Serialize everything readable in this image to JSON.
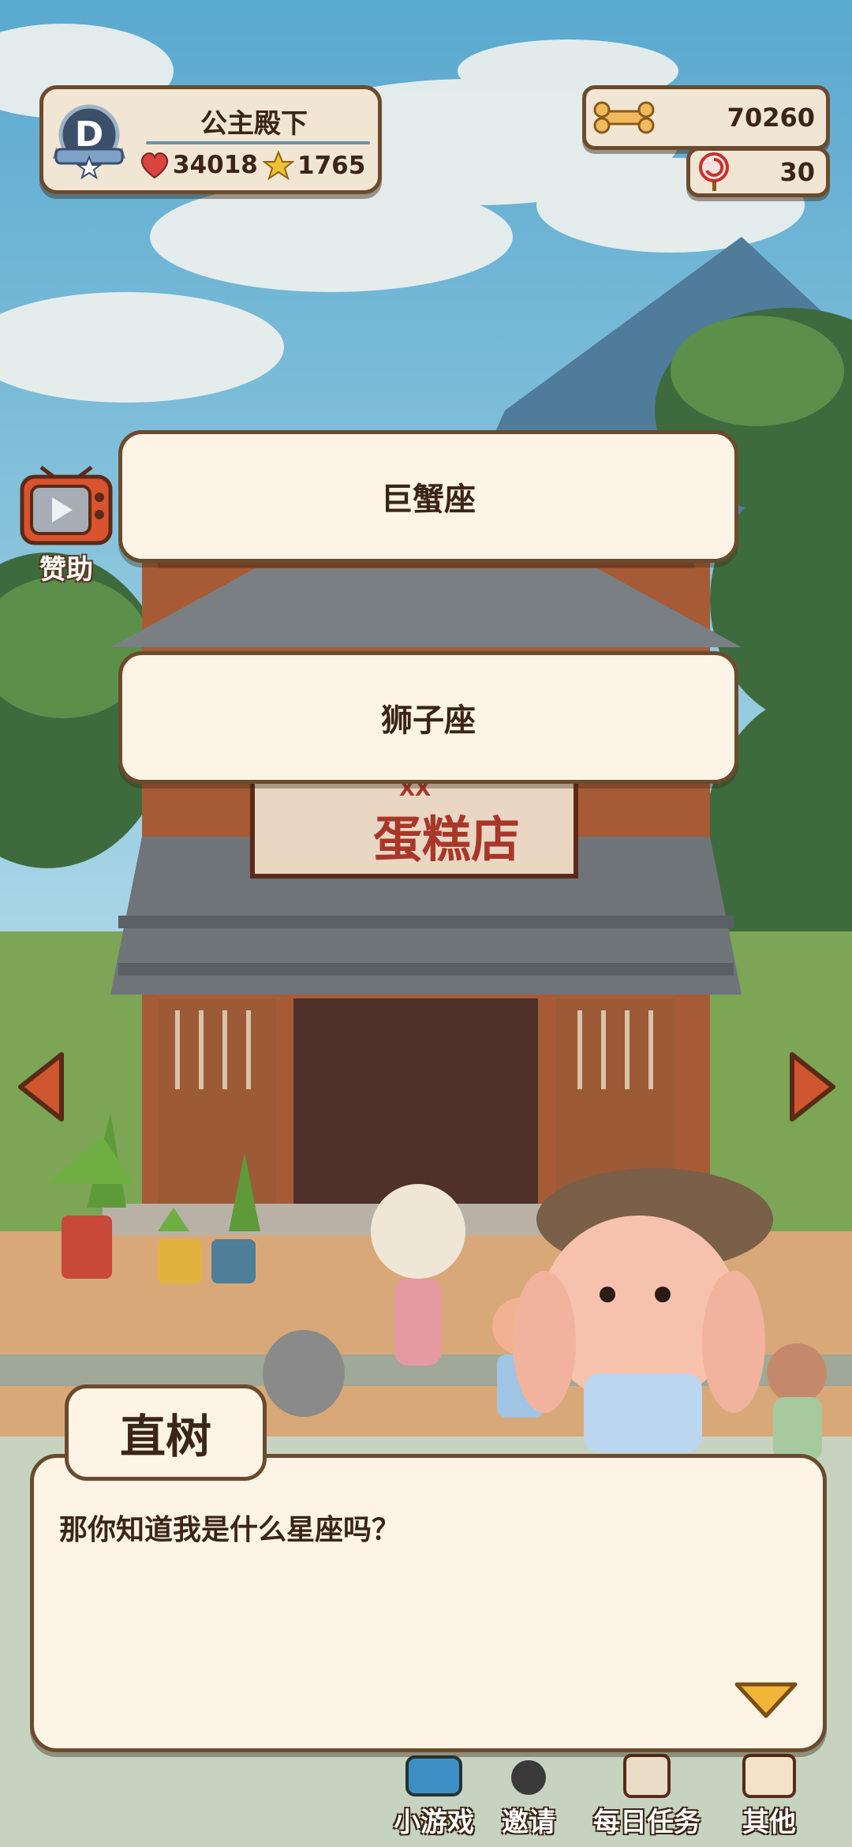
{
  "player": {
    "name": "公主殿下",
    "level_letter": "D",
    "hearts": "34018",
    "stars": "1765"
  },
  "currency": {
    "bones": "70260",
    "candy": "30"
  },
  "sponsor": {
    "label": "赞助",
    "icon": "tv-icon"
  },
  "choices": [
    {
      "label": "巨蟹座"
    },
    {
      "label": "狮子座"
    }
  ],
  "shop_sign": {
    "text": "蛋糕店",
    "top_text": "XX"
  },
  "dialog": {
    "speaker": "直树",
    "text": "那你知道我是什么星座吗？"
  },
  "bottom_nav": [
    {
      "label": "小游戏",
      "icon": "game-console-icon"
    },
    {
      "label": "邀请",
      "icon": "invite-icon"
    },
    {
      "label": "每日任务",
      "icon": "daily-task-icon"
    },
    {
      "label": "其他",
      "icon": "other-icon"
    }
  ],
  "colors": {
    "panel_bg": "#f1e6d3",
    "border": "#6b4a2d",
    "text": "#3b2516",
    "arrow": "#d0562f",
    "sky": "#8cc3dc"
  }
}
